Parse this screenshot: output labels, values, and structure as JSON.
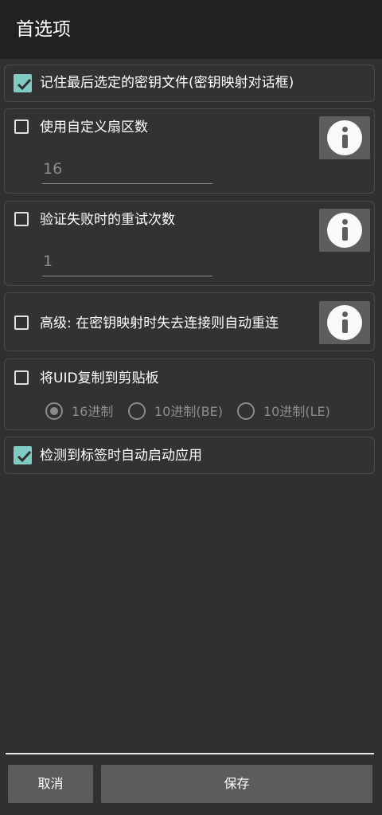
{
  "header": {
    "title": "首选项"
  },
  "options": {
    "remember_key": {
      "label": "记住最后选定的密钥文件(密钥映射对话框)",
      "checked": true
    },
    "custom_sectors": {
      "label": "使用自定义扇区数",
      "checked": false,
      "value": "16"
    },
    "retry_count": {
      "label": "验证失败时的重试次数",
      "checked": false,
      "value": "1"
    },
    "advanced_reconnect": {
      "label": "高级: 在密钥映射时失去连接则自动重连",
      "checked": false
    },
    "copy_uid": {
      "label": "将UID复制到剪贴板",
      "checked": false,
      "radio_options": [
        "16进制",
        "10进制(BE)",
        "10进制(LE)"
      ],
      "selected": "16进制"
    },
    "autostart": {
      "label": "检测到标签时自动启动应用",
      "checked": true
    }
  },
  "footer": {
    "cancel_label": "取消",
    "save_label": "保存"
  },
  "colors": {
    "accent": "#80cbc4",
    "background": "#303030",
    "appbar": "#212121",
    "button": "#5c5c5c"
  },
  "icons": {
    "info": "info-icon",
    "check": "check-icon"
  }
}
